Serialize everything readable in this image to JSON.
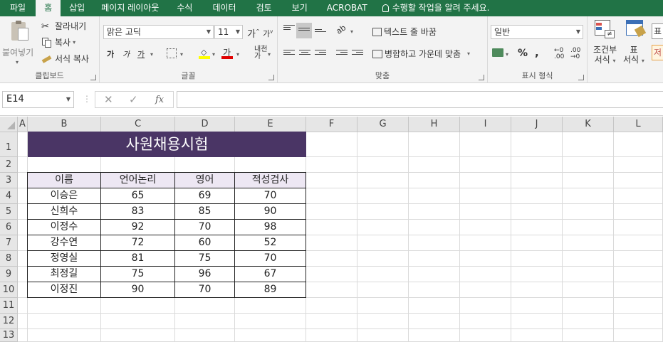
{
  "tabs": [
    "파일",
    "홈",
    "삽입",
    "페이지 레이아웃",
    "수식",
    "데이터",
    "검토",
    "보기",
    "ACROBAT"
  ],
  "tell_me": "수행할 작업을 알려 주세요.",
  "ribbon": {
    "clipboard": {
      "paste": "붙여넣기",
      "cut": "잘라내기",
      "copy": "복사",
      "format_painter": "서식 복사",
      "label": "클립보드"
    },
    "font": {
      "name": "맑은 고딕",
      "size": "11",
      "label": "글꼴"
    },
    "alignment": {
      "wrap_text": "텍스트 줄 바꿈",
      "merge_center": "병합하고 가운데 맞춤",
      "label": "맞춤"
    },
    "number": {
      "format": "일반",
      "label": "표시 형식"
    },
    "styles": {
      "conditional_1": "조건부",
      "conditional_2": "서식",
      "table_1": "표",
      "table_2": "서식",
      "cell_style_1": "표",
      "cell_style_2": "저"
    }
  },
  "formula_bar": {
    "name_box": "E14",
    "cancel": "✕",
    "enter": "✓",
    "fx": "fx",
    "value": ""
  },
  "sheet": {
    "columns": [
      "A",
      "B",
      "C",
      "D",
      "E",
      "F",
      "G",
      "H",
      "I",
      "J",
      "K",
      "L"
    ],
    "rows": [
      "1",
      "2",
      "3",
      "4",
      "5",
      "6",
      "7",
      "8",
      "9",
      "10",
      "11",
      "12",
      "13"
    ],
    "title": "사원채용시험",
    "table_headers": [
      "이름",
      "언어논리",
      "영어",
      "적성검사"
    ],
    "table_rows": [
      [
        "이승은",
        "65",
        "69",
        "70"
      ],
      [
        "신희수",
        "83",
        "85",
        "90"
      ],
      [
        "이정수",
        "92",
        "70",
        "98"
      ],
      [
        "강수연",
        "72",
        "60",
        "52"
      ],
      [
        "정영실",
        "81",
        "75",
        "70"
      ],
      [
        "최정길",
        "75",
        "96",
        "67"
      ],
      [
        "이정진",
        "90",
        "70",
        "89"
      ]
    ]
  },
  "colors": {
    "excel_green": "#217346",
    "title_fill": "#4a3565",
    "header_fill": "#ede7f3"
  }
}
